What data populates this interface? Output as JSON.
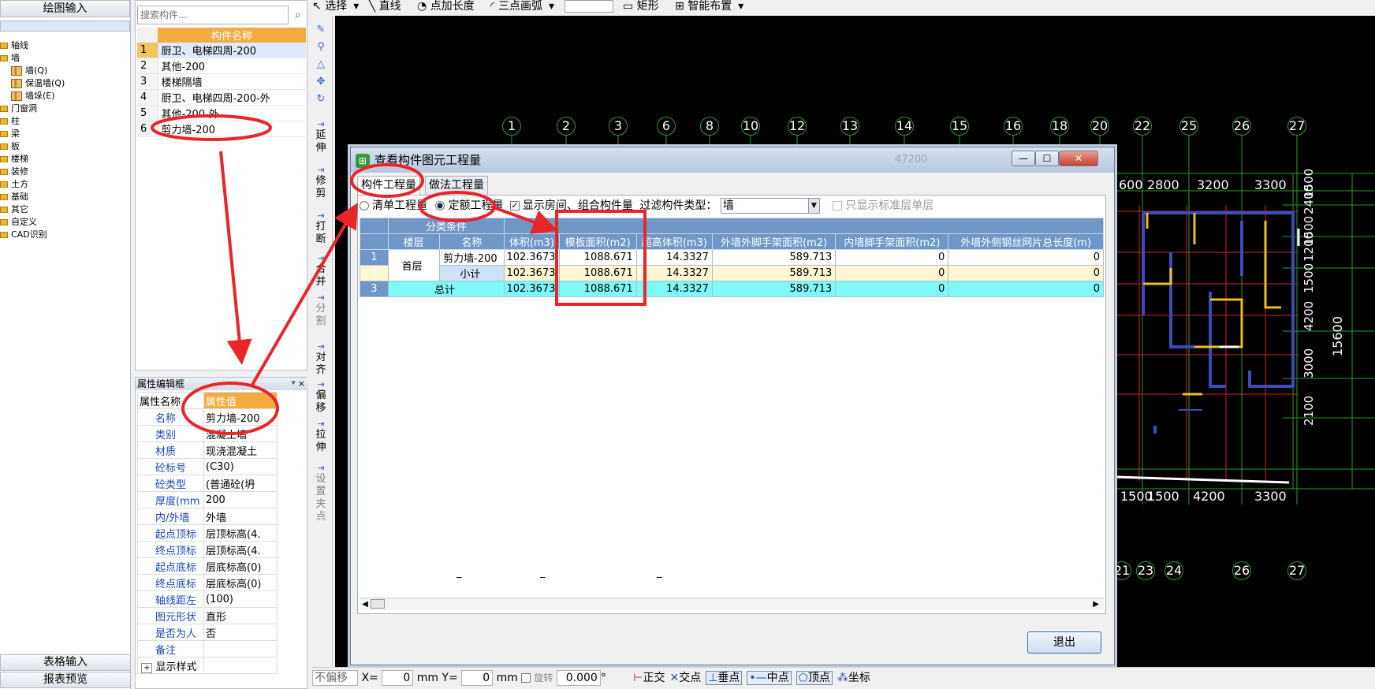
{
  "left_nav": {
    "header": "绘图输入",
    "tree": [
      {
        "label": "轴线"
      },
      {
        "label": "墙"
      },
      {
        "label": "墙(Q)",
        "child": true
      },
      {
        "label": "保温墙(Q)",
        "child": true
      },
      {
        "label": "墙垛(E)",
        "child": true
      },
      {
        "label": "门窗洞"
      },
      {
        "label": "柱"
      },
      {
        "label": "梁"
      },
      {
        "label": "板"
      },
      {
        "label": "楼梯"
      },
      {
        "label": "装修"
      },
      {
        "label": "土方"
      },
      {
        "label": "基础"
      },
      {
        "label": "其它"
      },
      {
        "label": "自定义"
      },
      {
        "label": "CAD识别"
      }
    ],
    "bottom1": "表格输入",
    "bottom2": "报表预览"
  },
  "component_list": {
    "search_placeholder": "搜索构件...",
    "column_header": "构件名称",
    "rows": [
      {
        "no": "1",
        "name": "厨卫、电梯四周-200"
      },
      {
        "no": "2",
        "name": "其他-200"
      },
      {
        "no": "3",
        "name": "楼梯隔墙"
      },
      {
        "no": "4",
        "name": "厨卫、电梯四周-200-外"
      },
      {
        "no": "5",
        "name": "其他-200-外"
      },
      {
        "no": "6",
        "name": "剪力墙-200"
      }
    ]
  },
  "property_panel": {
    "title": "属性编辑框",
    "pin": "ᵠ",
    "close": "×",
    "col_name": "属性名称",
    "col_value": "属性值",
    "rows": [
      {
        "k": "名称",
        "v": "剪力墙-200"
      },
      {
        "k": "类别",
        "v": "混凝土墙"
      },
      {
        "k": "材质",
        "v": "现浇混凝土"
      },
      {
        "k": "砼标号",
        "v": "(C30)"
      },
      {
        "k": "砼类型",
        "v": "(普通砼(坍"
      },
      {
        "k": "厚度(mm",
        "v": "200"
      },
      {
        "k": "内/外墙",
        "v": "外墙"
      },
      {
        "k": "起点顶标",
        "v": "层顶标高(4."
      },
      {
        "k": "终点顶标",
        "v": "层顶标高(4."
      },
      {
        "k": "起点底标",
        "v": "层底标高(0)"
      },
      {
        "k": "终点底标",
        "v": "层底标高(0)"
      },
      {
        "k": "轴线距左",
        "v": "(100)"
      },
      {
        "k": "图元形状",
        "v": "直形"
      },
      {
        "k": "是否为人",
        "v": "否"
      },
      {
        "k": "备注",
        "v": ""
      }
    ],
    "display_style": "显示样式"
  },
  "toolbar": {
    "select": "选择",
    "line": "直线",
    "point_length": "点加长度",
    "arc": "三点画弧",
    "rect": "矩形",
    "smart": "智能布置"
  },
  "vertical_tools": [
    {
      "label": "延伸",
      "icon": "extend-icon"
    },
    {
      "label": "修剪",
      "icon": "trim-icon"
    },
    {
      "label": "打断",
      "icon": "break-icon"
    },
    {
      "label": "合并",
      "icon": "merge-icon"
    },
    {
      "label": "分割",
      "icon": "split-icon"
    },
    {
      "label": "对齐",
      "icon": "align-icon"
    },
    {
      "label": "偏移",
      "icon": "offset-icon"
    },
    {
      "label": "拉伸",
      "icon": "stretch-icon"
    },
    {
      "label": "设置夹点",
      "icon": "grip-icon"
    }
  ],
  "cad": {
    "top_axes": [
      "1",
      "2",
      "3",
      "6",
      "8",
      "10",
      "12",
      "13",
      "14",
      "15",
      "16",
      "18",
      "20",
      "22",
      "25",
      "26",
      "27"
    ],
    "bottom_axes": [
      "21",
      "23",
      "24",
      "26",
      "27"
    ],
    "top_dims": [
      "600",
      "2800",
      "3200",
      "3300"
    ],
    "bottom_dims": [
      "1500",
      "1500",
      "4200",
      "3300"
    ],
    "right_dims": [
      "1500",
      "2400",
      "1500",
      "1200",
      "1500",
      "4200",
      "3000",
      "2100"
    ],
    "total_dim": "15600",
    "faded_dim": "47200"
  },
  "status": {
    "mode": "不偏移",
    "x_label": "X=",
    "x_val": "0",
    "y_label": "mm Y=",
    "y_val": "0",
    "mm": "mm",
    "rotate": "旋转",
    "angle": "0.000",
    "deg": "°",
    "snaps": [
      "正交",
      "交点",
      "垂点",
      "中点",
      "顶点",
      "坐标"
    ]
  },
  "dialog": {
    "title": "查看构件图元工程量",
    "tab1": "构件工程量",
    "tab2": "做法工程量",
    "opt1": "清单工程量",
    "opt2": "定额工程量",
    "opt3": "显示房间、组合构件量",
    "filter_label": "过滤构件类型：",
    "filter_value": "墙",
    "only_std": "只显示标准层单层",
    "group_header": "分类条件",
    "columns": [
      "楼层",
      "名称",
      "体积(m3)",
      "模板面积(m2)",
      "超高体积(m3)",
      "外墙外脚手架面积(m2)",
      "内墙脚手架面积(m2)",
      "外墙外侧钢丝网片总长度(m)"
    ],
    "rows": [
      {
        "no": "1",
        "floor": "首层",
        "name": "剪力墙-200",
        "vol": "102.3673",
        "form": "1088.671",
        "over": "14.3327",
        "ext": "589.713",
        "int": "0",
        "mesh": "0"
      },
      {
        "no": "2",
        "floor": "",
        "name": "小计",
        "vol": "102.3673",
        "form": "1088.671",
        "over": "14.3327",
        "ext": "589.713",
        "int": "0",
        "mesh": "0"
      },
      {
        "no": "3",
        "floor": "",
        "name": "总计",
        "vol": "102.3673",
        "form": "1088.671",
        "over": "14.3327",
        "ext": "589.713",
        "int": "0",
        "mesh": "0"
      }
    ],
    "footer_dashes": [
      "_",
      "_",
      "_"
    ],
    "exit": "退出",
    "win_buttons": [
      "—",
      "☐",
      "✕"
    ]
  },
  "colors": {
    "annotation": "#e8262a",
    "header_orange": "#f2ac42",
    "grid_header": "#6f98c8",
    "total_row": "#7ff8f8"
  }
}
